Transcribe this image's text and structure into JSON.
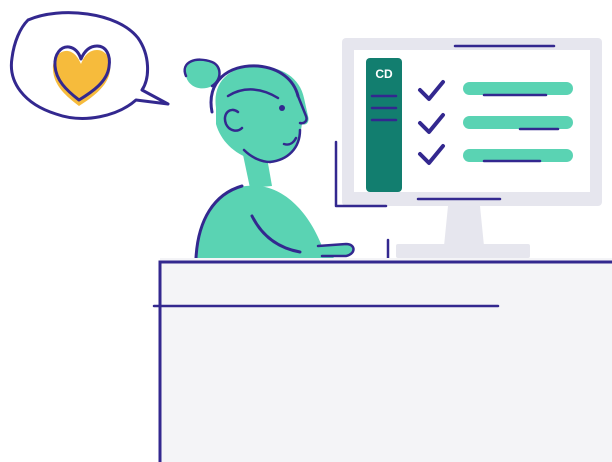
{
  "illustration": {
    "screen_logo_text": "CD",
    "checklist_count": 3
  },
  "colors": {
    "ink": "#33288f",
    "mint": "#5ad3b3",
    "teal": "#127e6f",
    "heart": "#f6bb3c",
    "monitor_frame": "#e6e6ee",
    "desk": "#f4f4f7",
    "background": "#ffffff"
  },
  "icons": [
    "heart-icon",
    "check-icon",
    "speech-bubble"
  ]
}
